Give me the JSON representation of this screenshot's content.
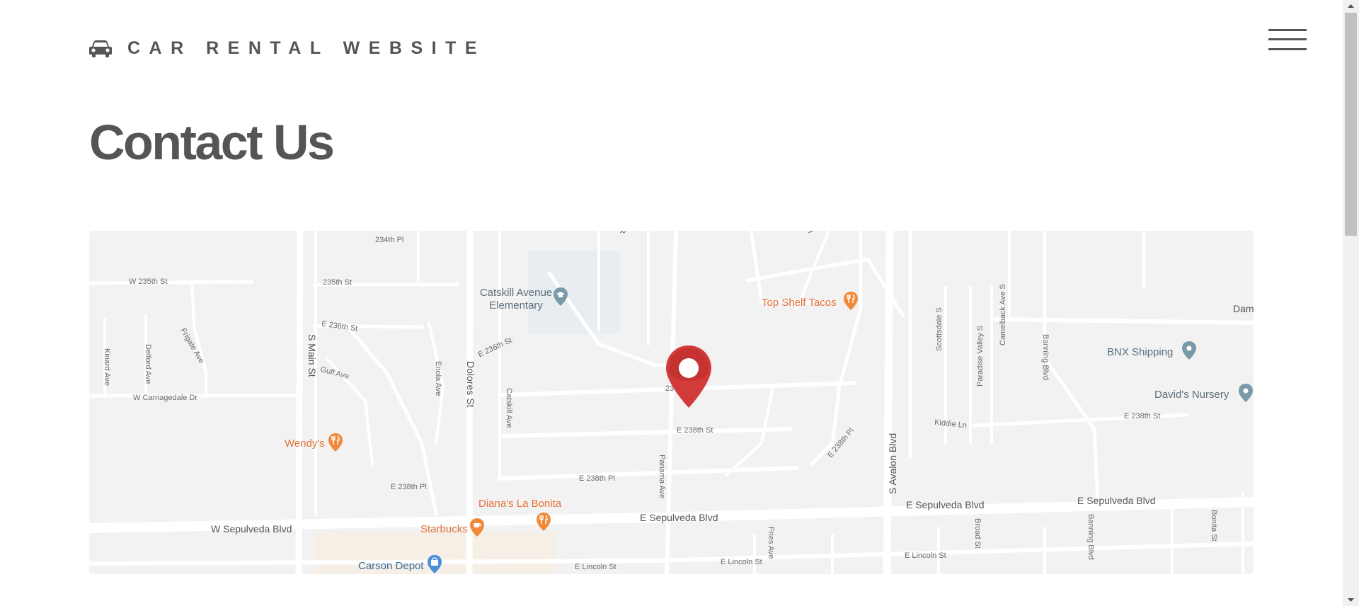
{
  "header": {
    "brand_label": "CAR RENTAL WEBSITE",
    "brand_icon": "car-icon",
    "menu_icon": "hamburger-menu-icon"
  },
  "page": {
    "title": "Contact Us"
  },
  "map": {
    "marker_icon": "map-pin-icon",
    "streets": {
      "s234_pl": "234th Pl",
      "w235_st": "W 235th St",
      "s235_st": "235th St",
      "e236_st": "E 236th St",
      "e236_st_b": "E 236th St",
      "gulf_ave": "Gulf Ave",
      "w_carriagedale": "W Carriagedale Dr",
      "kinard": "Kinard Ave",
      "delford": "Delford Ave",
      "frigate": "Frigate Ave",
      "s_main": "S Main St",
      "enola": "Enola Ave",
      "dolores": "Dolores St",
      "catskill_ave": "Catskill Ave",
      "e238_pl": "E 238th Pl",
      "e238_pl_b": "E 238th Pl",
      "e238_st": "E 238th St",
      "e238_st_b": "E 238th St",
      "e238th_pl_diag": "E 238th Pl",
      "panama": "Panama Ave",
      "s_avalon": "S Avalon Blvd",
      "scottsdale": "Scottsdale S",
      "paradise": "Paradise Valley S",
      "camelback": "Camelback Ave S",
      "banning": "Banning Blvd",
      "banning_b": "Banning Blvd",
      "kiddie": "Kiddie Ln",
      "w_sepulveda": "W Sepulveda Blvd",
      "e_sepulveda_1": "E Sepulveda Blvd",
      "e_sepulveda_2": "E Sepulveda Blvd",
      "e_sepulveda_3": "E Sepulveda Blvd",
      "e_lincoln_1": "E Lincoln St",
      "e_lincoln_2": "E Lincoln St",
      "e_lincoln_3": "E Lincoln St",
      "fries": "Fries Ave",
      "broad": "Broad St",
      "bonita": "Bonita St",
      "r_cut": "R",
      "a_cut": "A",
      "dam_cut": "Dam",
      "s23_cut": "23"
    },
    "places": {
      "catskill_school": "Catskill Avenue Elementary",
      "top_shelf": "Top Shelf Tacos",
      "bnx": "BNX Shipping",
      "davids": "David's Nursery",
      "wendys": "Wendy's",
      "dianas": "Diana's La Bonita",
      "starbucks": "Starbucks",
      "carson_depot": "Carson Depot"
    },
    "colors": {
      "background": "#f2f2f2",
      "road": "#ffffff",
      "food_poi": "#e5723a",
      "gray_poi": "#7a9aaa",
      "blue_poi": "#4a8fd8",
      "marker": "#d33a3a"
    }
  }
}
